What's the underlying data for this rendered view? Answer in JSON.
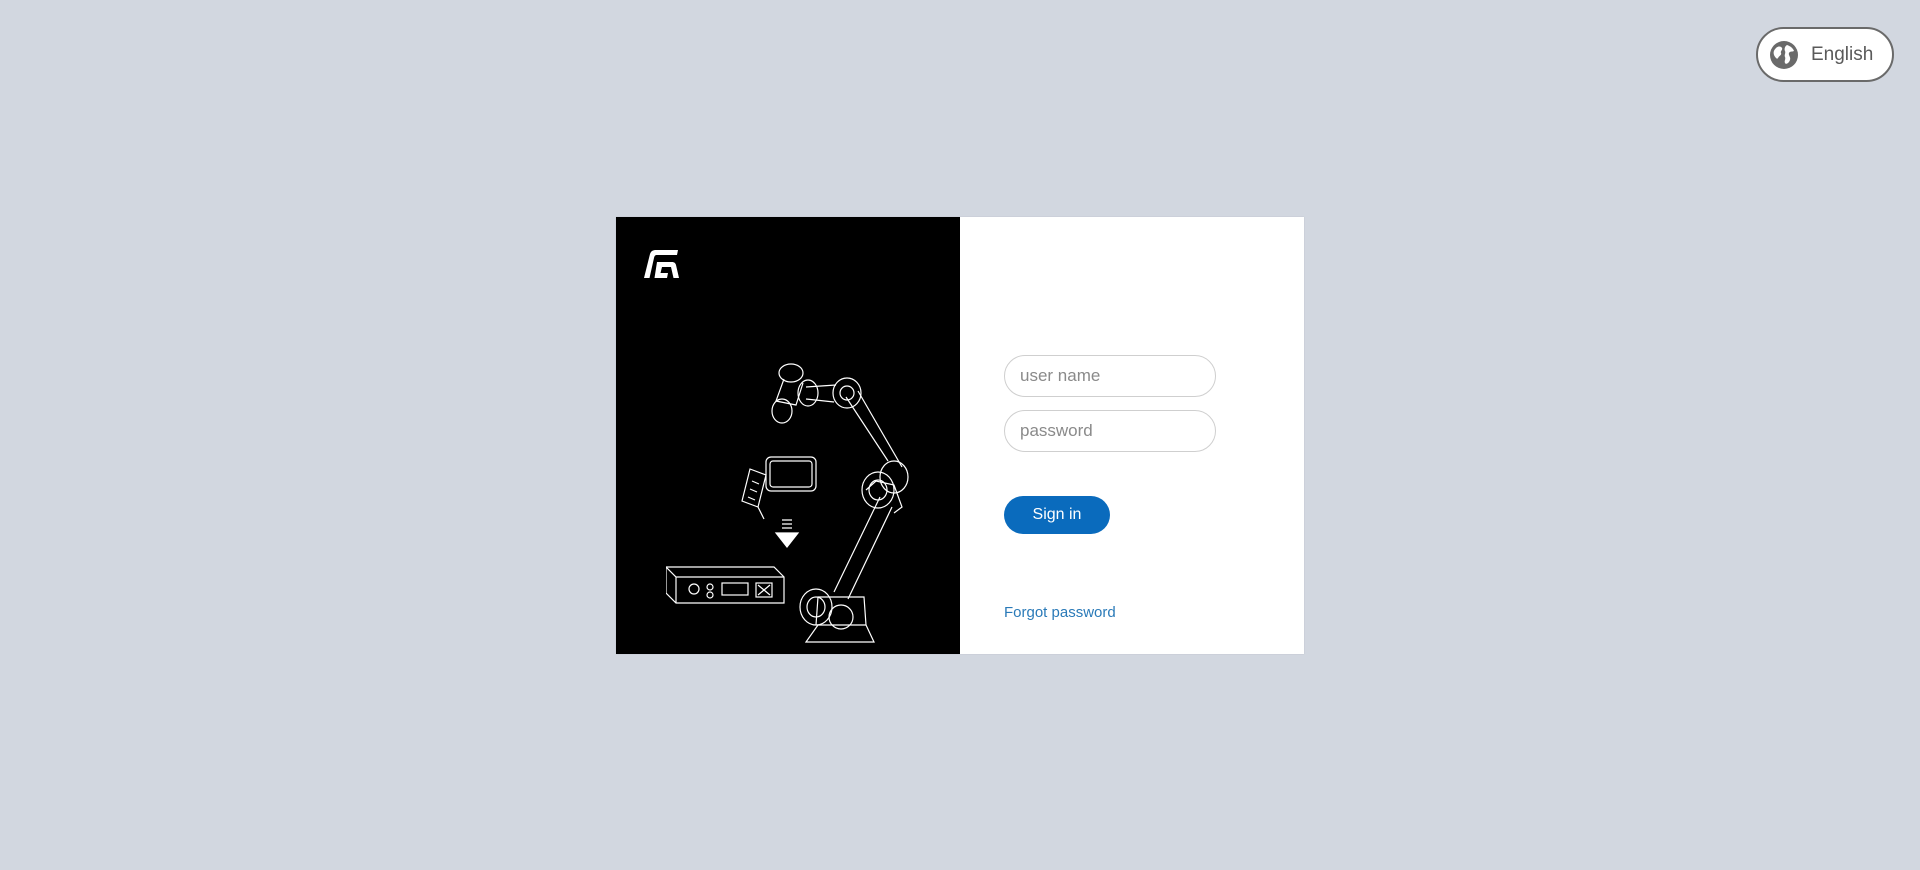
{
  "language": {
    "label": "English",
    "icon": "globe-icon"
  },
  "brand": {
    "logo_icon": "brand-logo-icon",
    "illustration": "robot-arm-controller-illustration"
  },
  "login": {
    "username_placeholder": "user name",
    "username_value": "",
    "password_placeholder": "password",
    "password_value": "",
    "signin_label": "Sign in",
    "forgot_label": "Forgot password"
  },
  "colors": {
    "page_background": "#d2d7e0",
    "left_panel": "#000000",
    "primary_button": "#0a6bbd",
    "link": "#2a7ab8"
  }
}
